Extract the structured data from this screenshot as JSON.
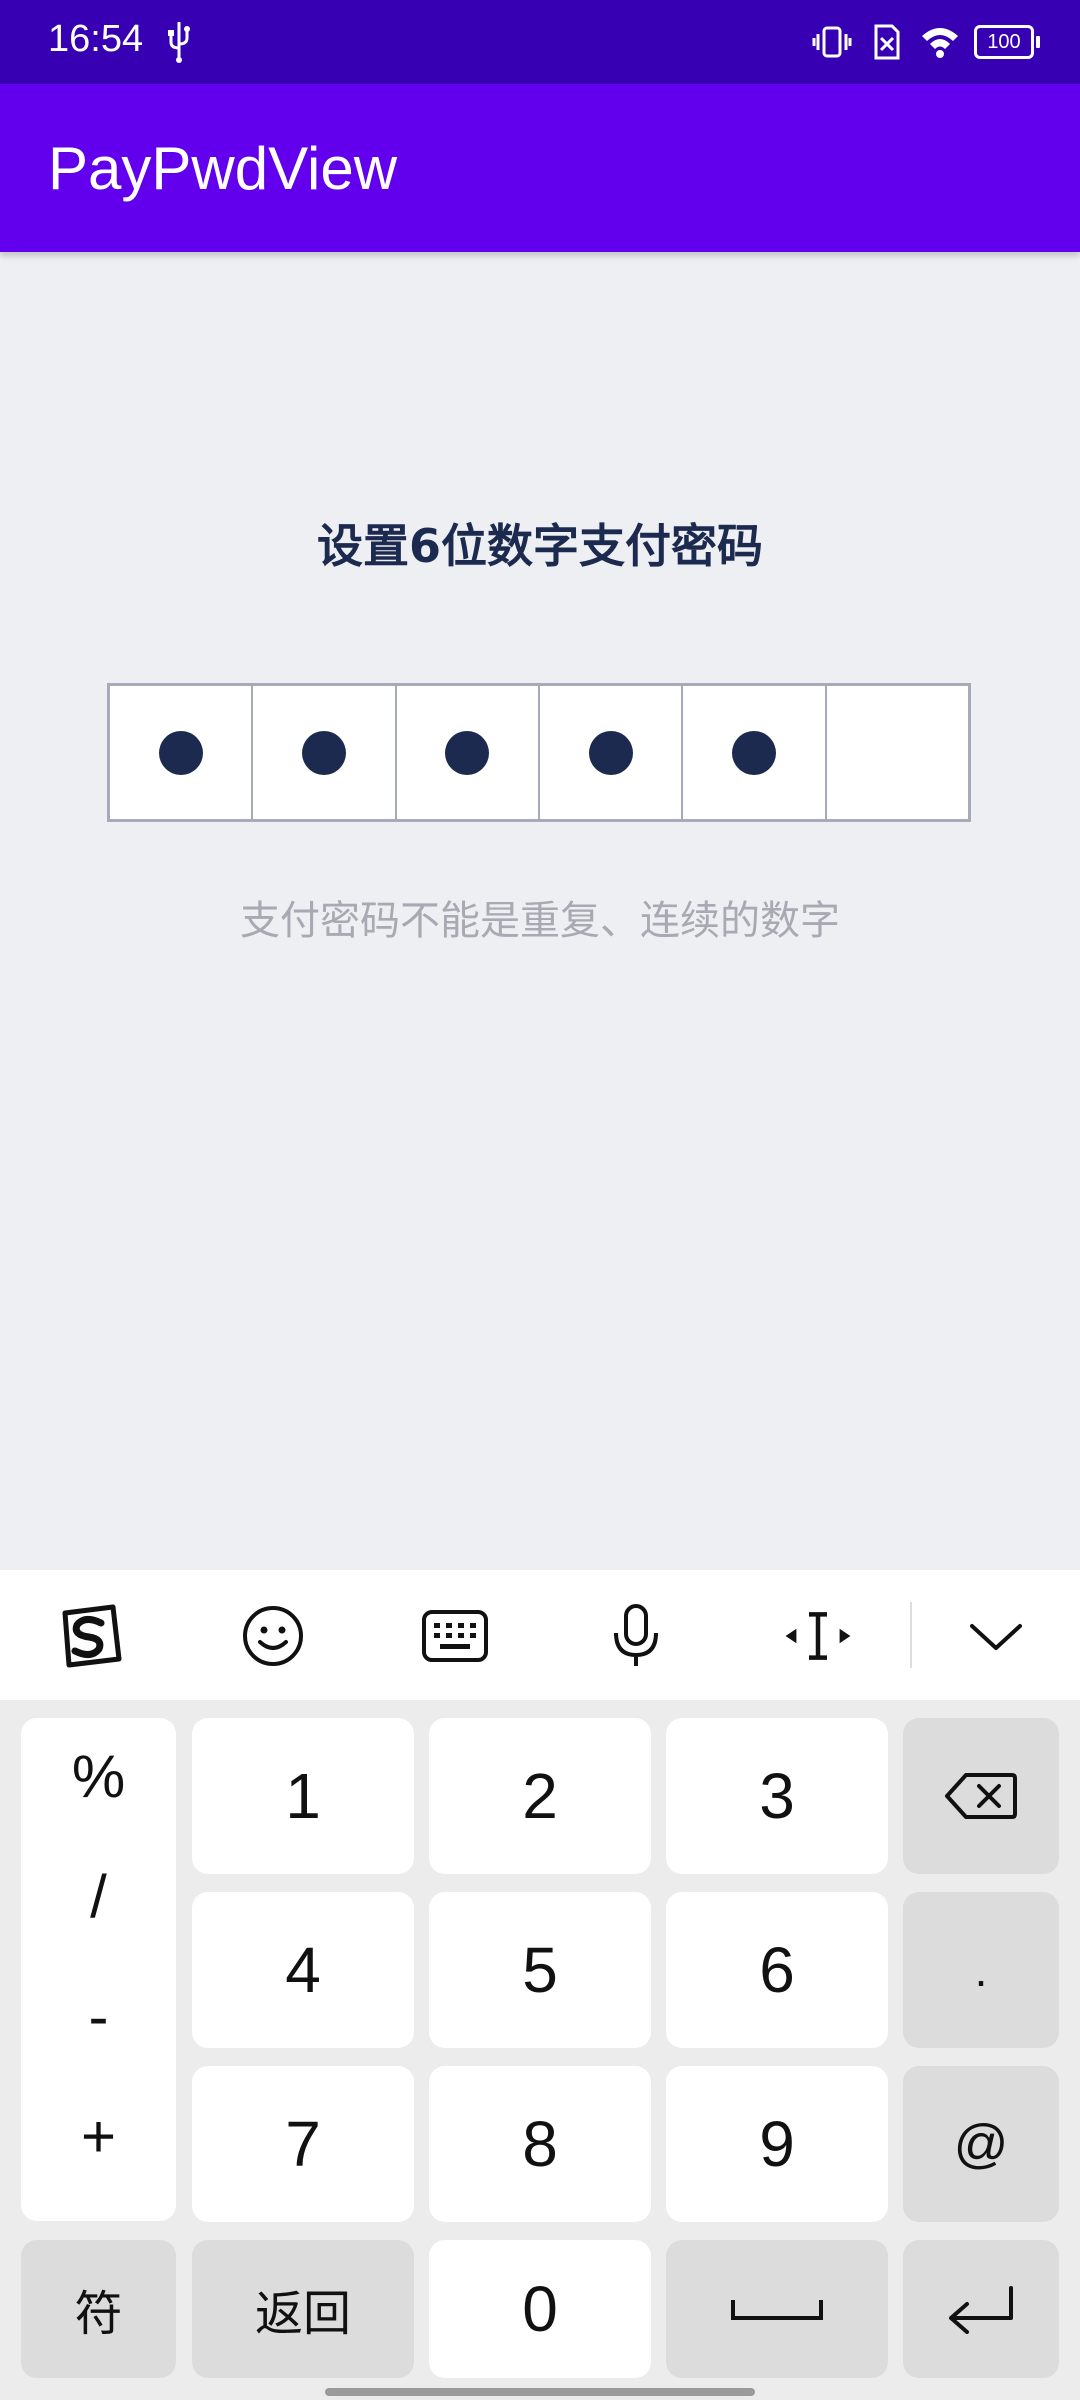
{
  "status": {
    "time": "16:54",
    "battery": "100",
    "icons": [
      "usb-icon",
      "vibrate-icon",
      "no-sim-icon",
      "wifi-icon",
      "battery-icon"
    ]
  },
  "appbar": {
    "title": "PayPwdView",
    "color": "#6200ee",
    "status_color": "#3700b3"
  },
  "main": {
    "heading": "设置6位数字支付密码",
    "pin_length": 6,
    "filled_count": 5,
    "hint": "支付密码不能是重复、连续的数字"
  },
  "keyboard": {
    "toolbar_icons": [
      "sogou-logo-icon",
      "emoji-icon",
      "keyboard-icon",
      "microphone-icon",
      "cursor-move-icon",
      "collapse-keyboard-icon"
    ],
    "symbols": [
      "%",
      "/",
      "-",
      "+"
    ],
    "digits": [
      "1",
      "2",
      "3",
      "4",
      "5",
      "6",
      "7",
      "8",
      "9",
      "0"
    ],
    "dot": ".",
    "at": "@",
    "symbol_key": "符",
    "back_key": "返回"
  }
}
